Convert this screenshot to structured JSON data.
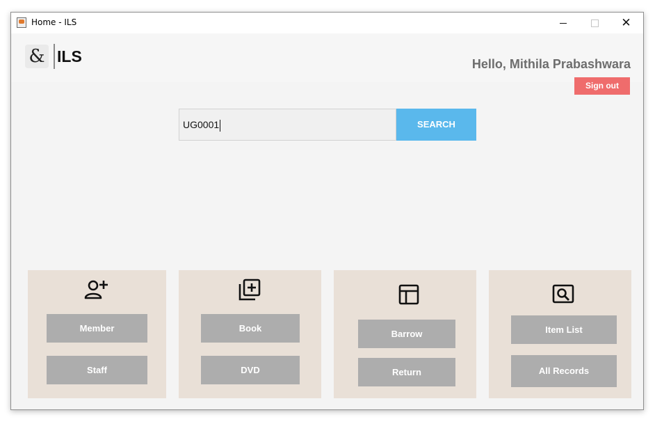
{
  "window": {
    "title": "Home - ILS",
    "controls": {
      "minimize": "minimize",
      "maximize": "maximize",
      "close": "✕"
    }
  },
  "header": {
    "logo_glyph": "&",
    "logo_text": "ILS",
    "greeting": "Hello, Mithila Prabashwara",
    "signout_label": "Sign out"
  },
  "search": {
    "value": "UG0001",
    "button_label": "SEARCH"
  },
  "cards": {
    "users": {
      "icon": "add-person-icon",
      "buttons": [
        "Member",
        "Staff"
      ]
    },
    "items": {
      "icon": "library-add-icon",
      "buttons": [
        "Book",
        "DVD"
      ]
    },
    "transactions": {
      "icon": "table-layout-icon",
      "buttons": [
        "Barrow",
        "Return"
      ]
    },
    "reports": {
      "icon": "image-search-icon",
      "buttons": [
        "Item List",
        "All Records"
      ]
    }
  },
  "colors": {
    "search_button": "#5ab8ec",
    "signout_button": "#ef6c6c",
    "card_background": "#e9e0d7",
    "card_button": "#adadad"
  }
}
